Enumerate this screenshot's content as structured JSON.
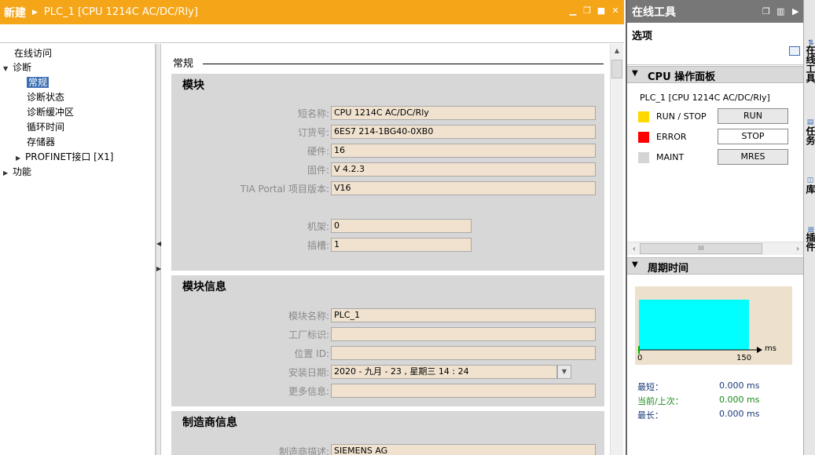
{
  "title_bar": {
    "project": "新建",
    "device": "PLC_1 [CPU 1214C AC/DC/Rly]",
    "controls": [
      "minimize-icon",
      "restore-icon",
      "maximize-icon",
      "close-icon"
    ]
  },
  "tree": {
    "items": [
      {
        "label": "在线访问",
        "level": 0,
        "toggle": ""
      },
      {
        "label": "诊断",
        "level": 0,
        "toggle": "▼"
      },
      {
        "label": "常规",
        "level": 1,
        "toggle": "",
        "selected": true
      },
      {
        "label": "诊断状态",
        "level": 1,
        "toggle": ""
      },
      {
        "label": "诊断缓冲区",
        "level": 1,
        "toggle": ""
      },
      {
        "label": "循环时间",
        "level": 1,
        "toggle": ""
      },
      {
        "label": "存储器",
        "level": 1,
        "toggle": ""
      },
      {
        "label": "PROFINET接口 [X1]",
        "level": 1,
        "toggle": "▶"
      },
      {
        "label": "功能",
        "level": 0,
        "toggle": "▶"
      }
    ]
  },
  "main": {
    "tab": "常规",
    "module": {
      "title": "模块",
      "fields": [
        {
          "label": "短名称:",
          "value": "CPU 1214C AC/DC/Rly"
        },
        {
          "label": "订货号:",
          "value": "6ES7 214-1BG40-0XB0"
        },
        {
          "label": "硬件:",
          "value": "16"
        },
        {
          "label": "固件:",
          "value": "V 4.2.3"
        },
        {
          "label": "TIA Portal 项目版本:",
          "value": "V16"
        },
        {
          "label": "机架:",
          "value": "0"
        },
        {
          "label": "插槽:",
          "value": "1"
        }
      ]
    },
    "module_info": {
      "title": "模块信息",
      "fields": [
        {
          "label": "模块名称:",
          "value": "PLC_1"
        },
        {
          "label": "工厂标识:",
          "value": ""
        },
        {
          "label": "位置 ID:",
          "value": ""
        },
        {
          "label": "安装日期:",
          "value": "2020 - 九月  - 23 , 星期三     14 : 24"
        },
        {
          "label": "更多信息:",
          "value": ""
        }
      ]
    },
    "manufacturer_info": {
      "title": "制造商信息",
      "fields": [
        {
          "label": "制造商描述:",
          "value": "SIEMENS AG"
        }
      ]
    }
  },
  "right_panel": {
    "title": "在线工具",
    "options_label": "选项",
    "cpu_panel": {
      "title": "CPU 操作面板",
      "device": "PLC_1 [CPU 1214C AC/DC/Rly]",
      "leds": [
        {
          "label": "RUN / STOP",
          "color": "#ffd800"
        },
        {
          "label": "ERROR",
          "color": "#ff0000"
        },
        {
          "label": "MAINT",
          "color": "#d4d4d4"
        }
      ],
      "buttons": [
        "RUN",
        "STOP",
        "MRES"
      ]
    },
    "cycle_time": {
      "title": "周期时间",
      "axis_unit": "ms",
      "axis_min": "0",
      "axis_max": "150",
      "stats": [
        {
          "label": "最短：",
          "value": "0.000 ms",
          "color": "#1a3c78"
        },
        {
          "label": "当前/上次：",
          "value": "0.000 ms",
          "color": "#1a8a1a"
        },
        {
          "label": "最长：",
          "value": "0.000 ms",
          "color": "#1a3c78"
        }
      ],
      "bar_color": "#00ffff",
      "scrollbar_glyph": "III"
    }
  },
  "side_tabs": [
    "在线工具",
    "任务",
    "库",
    "插件"
  ]
}
